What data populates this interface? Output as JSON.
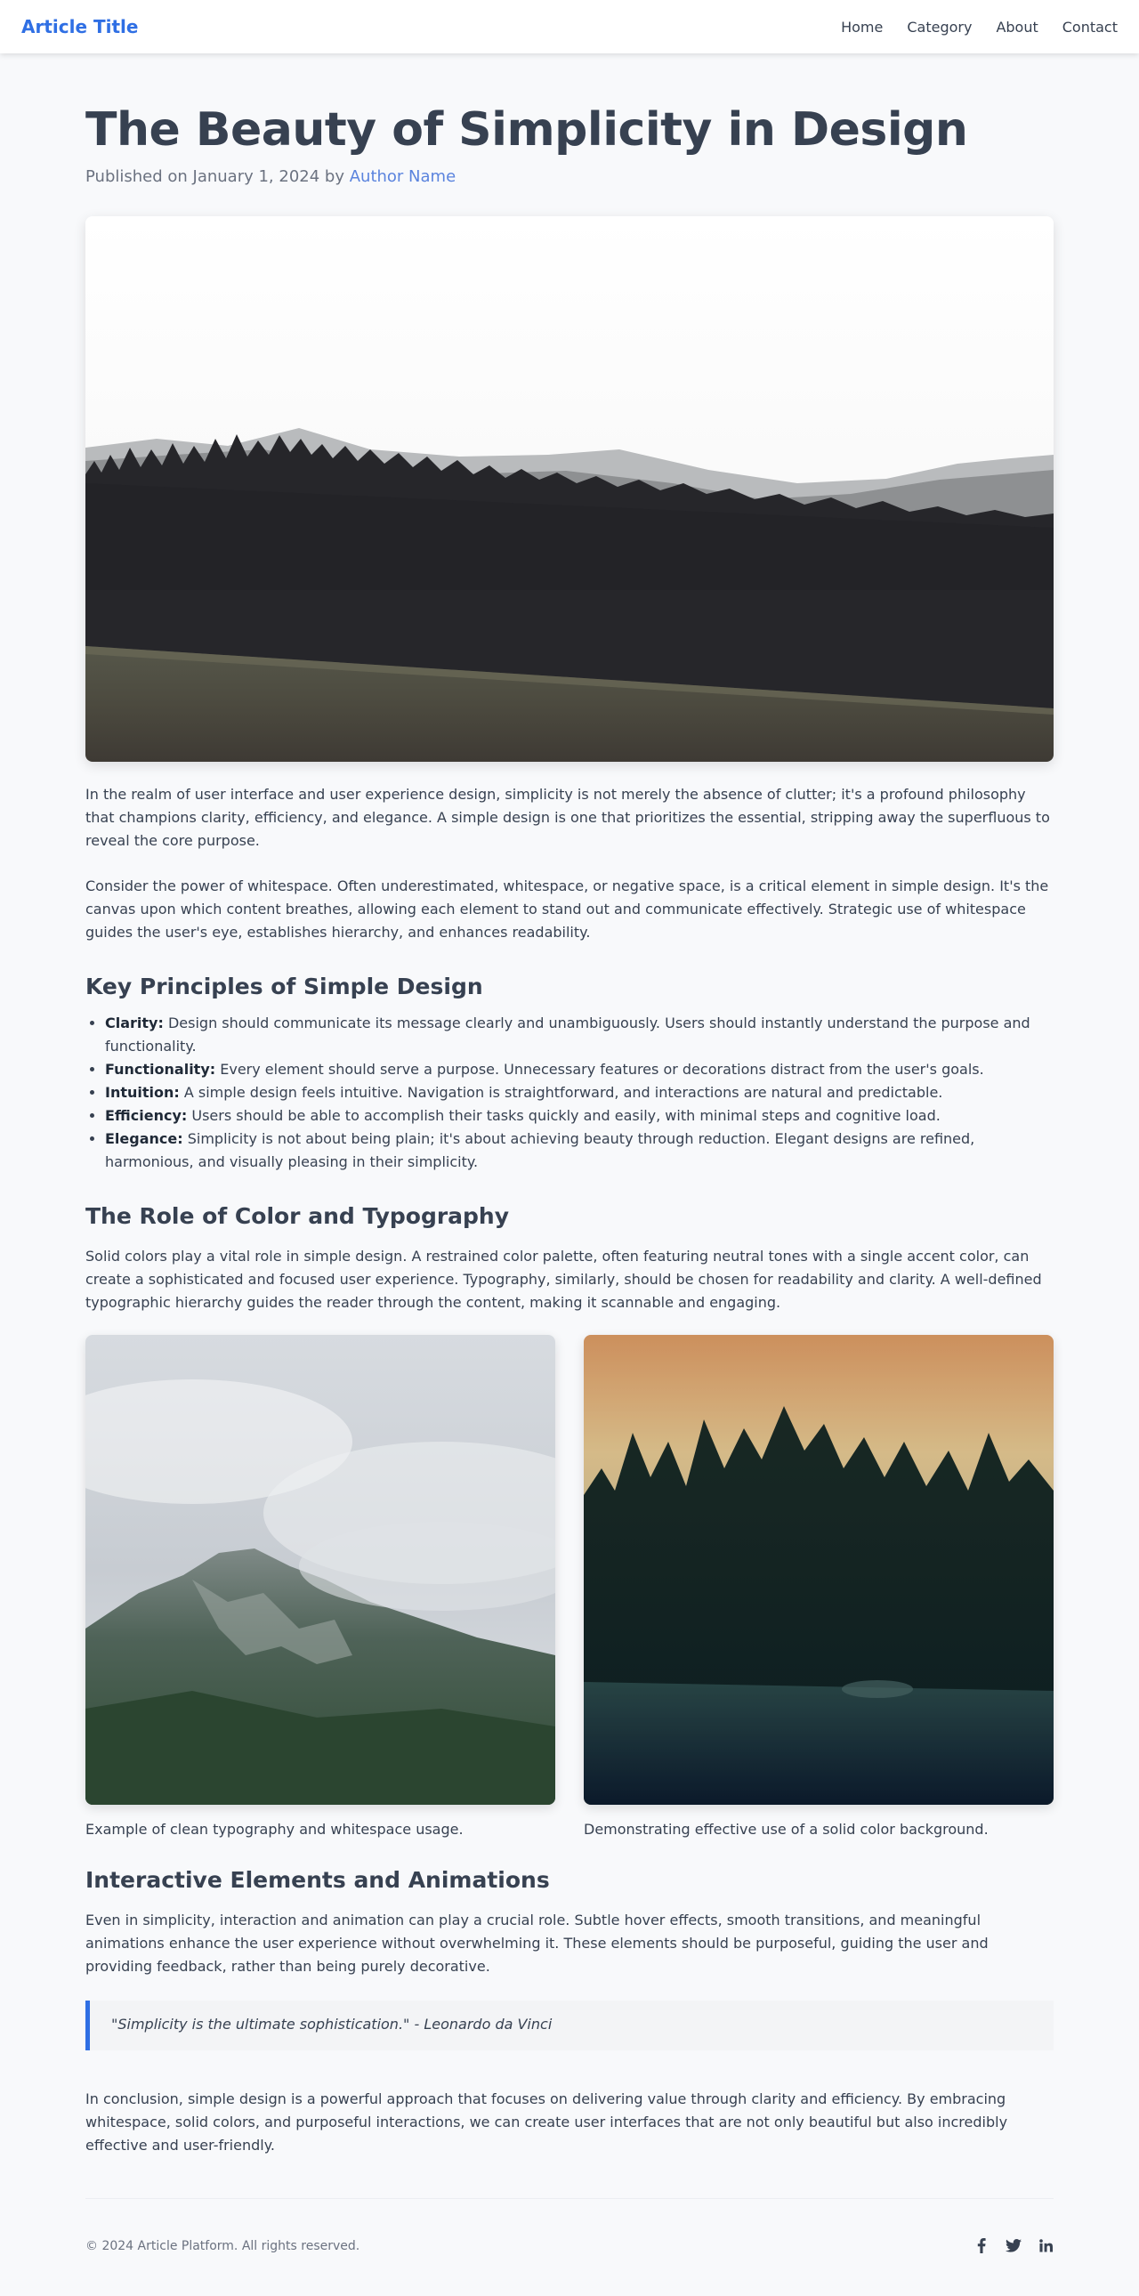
{
  "header": {
    "brand": "Article Title",
    "nav": [
      "Home",
      "Category",
      "About",
      "Contact"
    ]
  },
  "article": {
    "title": "The Beauty of Simplicity in Design",
    "meta_prefix": "Published on January 1, 2024 by ",
    "author": "Author Name",
    "intro_1": "In the realm of user interface and user experience design, simplicity is not merely the absence of clutter; it's a profound philosophy that champions clarity, efficiency, and elegance. A simple design is one that prioritizes the essential, stripping away the superfluous to reveal the core purpose.",
    "intro_2": "Consider the power of whitespace. Often underestimated, whitespace, or negative space, is a critical element in simple design. It's the canvas upon which content breathes, allowing each element to stand out and communicate effectively. Strategic use of whitespace guides the user's eye, establishes hierarchy, and enhances readability.",
    "section_1": {
      "heading": "Key Principles of Simple Design",
      "items": [
        {
          "term": "Clarity:",
          "text": " Design should communicate its message clearly and unambiguously. Users should instantly understand the purpose and functionality."
        },
        {
          "term": "Functionality:",
          "text": " Every element should serve a purpose. Unnecessary features or decorations distract from the user's goals."
        },
        {
          "term": "Intuition:",
          "text": " A simple design feels intuitive. Navigation is straightforward, and interactions are natural and predictable."
        },
        {
          "term": "Efficiency:",
          "text": " Users should be able to accomplish their tasks quickly and easily, with minimal steps and cognitive load."
        },
        {
          "term": "Elegance:",
          "text": " Simplicity is not about being plain; it's about achieving beauty through reduction. Elegant designs are refined, harmonious, and visually pleasing in their simplicity."
        }
      ]
    },
    "section_2": {
      "heading": "The Role of Color and Typography",
      "text": "Solid colors play a vital role in simple design. A restrained color palette, often featuring neutral tones with a single accent color, can create a sophisticated and focused user experience. Typography, similarly, should be chosen for readability and clarity. A well-defined typographic hierarchy guides the reader through the content, making it scannable and engaging.",
      "captions": [
        "Example of clean typography and whitespace usage.",
        "Demonstrating effective use of a solid color background."
      ]
    },
    "section_3": {
      "heading": "Interactive Elements and Animations",
      "text": "Even in simplicity, interaction and animation can play a crucial role. Subtle hover effects, smooth transitions, and meaningful animations enhance the user experience without overwhelming it. These elements should be purposeful, guiding the user and providing feedback, rather than being purely decorative.",
      "quote": "\"Simplicity is the ultimate sophistication.\" - Leonardo da Vinci"
    },
    "conclusion": "In conclusion, simple design is a powerful approach that focuses on delivering value through clarity and efficiency. By embracing whitespace, solid colors, and purposeful interactions, we can create user interfaces that are not only beautiful but also incredibly effective and user-friendly."
  },
  "footer": {
    "copyright": "© 2024 Article Platform. All rights reserved.",
    "social_icons": [
      "facebook-icon",
      "twitter-icon",
      "linkedin-icon"
    ]
  },
  "colors": {
    "accent": "#2f6fe4",
    "text": "#374151",
    "muted": "#6b7280",
    "background": "#f8f9fb"
  }
}
